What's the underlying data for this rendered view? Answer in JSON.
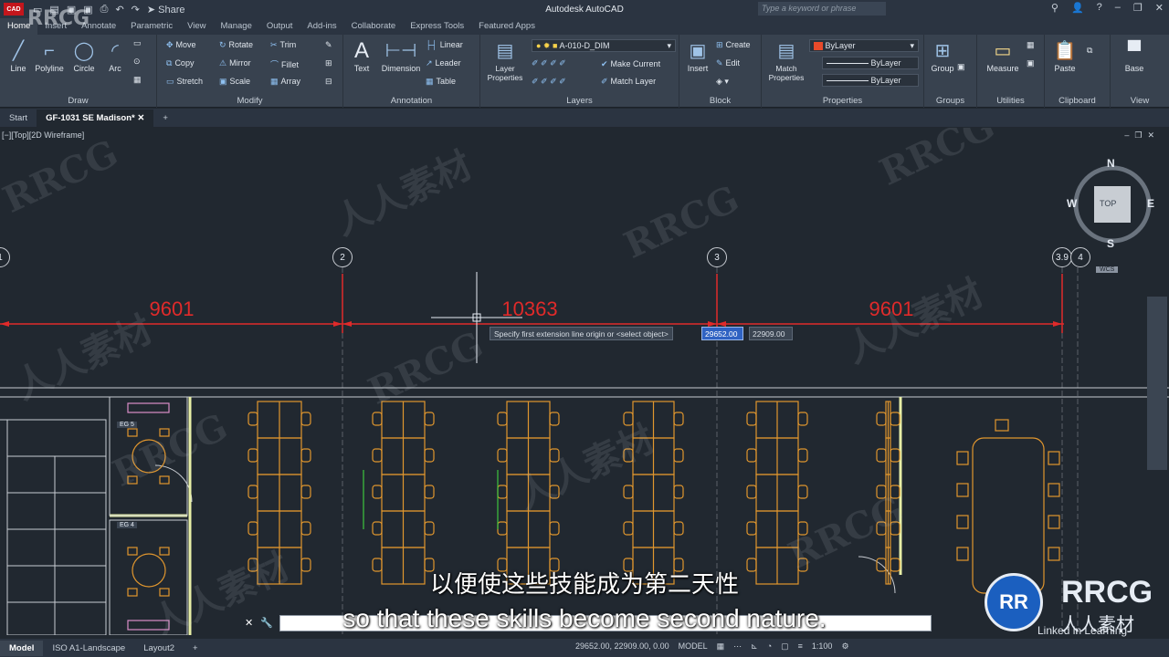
{
  "app": {
    "title": "Autodesk AutoCAD",
    "logo_text": "CAD",
    "share_label": "Share"
  },
  "search": {
    "placeholder": "Type a keyword or phrase"
  },
  "ribbon_tabs": [
    "Home",
    "Insert",
    "Annotate",
    "Parametric",
    "View",
    "Manage",
    "Output",
    "Add-ins",
    "Collaborate",
    "Express Tools",
    "Featured Apps"
  ],
  "panels": {
    "draw": {
      "title": "Draw",
      "line": "Line",
      "polyline": "Polyline",
      "circle": "Circle",
      "arc": "Arc"
    },
    "modify": {
      "title": "Modify",
      "move": "Move",
      "rotate": "Rotate",
      "trim": "Trim",
      "copy": "Copy",
      "mirror": "Mirror",
      "fillet": "Fillet",
      "stretch": "Stretch",
      "scale": "Scale",
      "array": "Array"
    },
    "annotation": {
      "title": "Annotation",
      "text": "Text",
      "dimension": "Dimension",
      "linear": "Linear",
      "leader": "Leader",
      "table": "Table"
    },
    "layers": {
      "title": "Layers",
      "layer_properties": "Layer Properties",
      "current_layer": "A-010-D_DIM",
      "make_current": "Make Current",
      "match_layer": "Match Layer"
    },
    "block": {
      "title": "Block",
      "insert": "Insert",
      "create": "Create",
      "edit": "Edit"
    },
    "properties": {
      "title": "Properties",
      "match_properties": "Match Properties",
      "color": "ByLayer",
      "linetype": "ByLayer",
      "lineweight": "ByLayer"
    },
    "groups": {
      "title": "Groups",
      "group": "Group"
    },
    "utilities": {
      "title": "Utilities",
      "measure": "Measure"
    },
    "clipboard": {
      "title": "Clipboard",
      "paste": "Paste"
    },
    "view": {
      "title": "View",
      "base": "Base"
    }
  },
  "file_tabs": {
    "start": "Start",
    "active": "GF-1031 SE Madison*"
  },
  "viewport": {
    "label": "[−][Top][2D Wireframe]",
    "viewcube": {
      "n": "N",
      "s": "S",
      "e": "E",
      "w": "W",
      "face": "TOP",
      "wcs": "WCS"
    }
  },
  "drawing": {
    "grid_bubbles": [
      "1",
      "2",
      "3",
      "3.9",
      "4"
    ],
    "dimensions": [
      "9601",
      "10363",
      "9601"
    ],
    "room_tags": [
      "EG 5",
      "EG 4"
    ]
  },
  "prompt": {
    "text": "Specify first extension line origin or <select object>",
    "x": "29652.00",
    "y": "22909.00"
  },
  "statusbar": {
    "layouts": [
      "Model",
      "ISO A1-Landscape",
      "Layout2"
    ],
    "coords": "29652.00, 22909.00, 0.00",
    "model": "MODEL",
    "scale": "1:100"
  },
  "subtitles": {
    "cn": "以便使这些技能成为第二天性",
    "en": "so that these skills become second nature."
  },
  "watermarks": {
    "rrcg": "RRCG",
    "cn": "人人素材",
    "linkedin": "Linked in Learning"
  },
  "brand": {
    "logo": "RR",
    "name": "RRCG",
    "cn": "人人素材"
  }
}
